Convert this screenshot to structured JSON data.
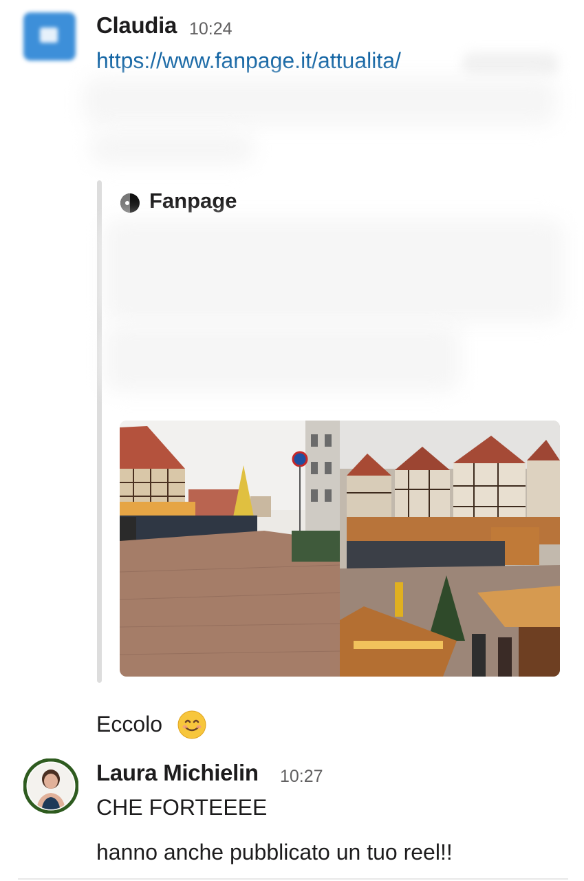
{
  "messages": [
    {
      "sender": "Claudia",
      "time": "10:24",
      "link": "https://www.fanpage.it/attualita/",
      "unfurl": {
        "source": "Fanpage",
        "source_icon": "fanpage-logo-icon",
        "image": "christmas-market-photo"
      },
      "followup": "Eccolo",
      "followup_emoji": "smiling-face-emoji"
    },
    {
      "sender": "Laura Michielin",
      "time": "10:27",
      "lines": [
        "CHE FORTEEEE",
        "hanno anche pubblicato un tuo reel!!"
      ]
    }
  ],
  "colors": {
    "link": "#1264a3",
    "text": "#1d1c1d",
    "timestamp": "#616061",
    "attachment_bar": "#dddddd",
    "avatar_claudia": "#3d8fd9",
    "avatar_laura_ring": "#2e5b1f"
  }
}
